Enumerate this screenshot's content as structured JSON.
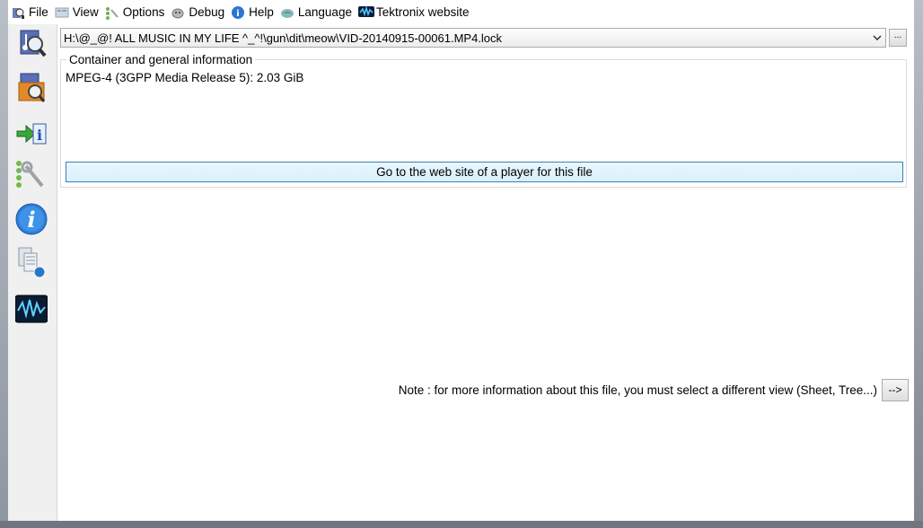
{
  "menu": {
    "items": [
      {
        "label": "File",
        "icon": "file-icon"
      },
      {
        "label": "View",
        "icon": "view-icon"
      },
      {
        "label": "Options",
        "icon": "options-icon"
      },
      {
        "label": "Debug",
        "icon": "debug-icon"
      },
      {
        "label": "Help",
        "icon": "help-icon"
      },
      {
        "label": "Language",
        "icon": "language-icon"
      },
      {
        "label": "Tektronix website",
        "icon": "tektronix-icon"
      }
    ]
  },
  "toolbar": {
    "tools": [
      {
        "name": "open-file-icon"
      },
      {
        "name": "open-folder-icon"
      },
      {
        "name": "export-icon"
      },
      {
        "name": "preferences-icon"
      },
      {
        "name": "about-icon"
      },
      {
        "name": "knowledge-base-icon"
      },
      {
        "name": "tektronix-waveform-icon"
      }
    ]
  },
  "file": {
    "path": "H:\\@_@! ALL MUSIC IN MY LIFE ^_^!\\gun\\dit\\meow\\VID-20140915-00061.MP4.lock",
    "browse_label": "..."
  },
  "general": {
    "legend": "Container and general information",
    "format": "MPEG-4 (3GPP Media Release 5): 2.03 GiB",
    "player_button": "Go to the web site of a player for this file"
  },
  "note": {
    "text": "Note : for more information about this file, you must select a different view (Sheet, Tree...)",
    "arrow_label": "-->"
  },
  "colors": {
    "accent_border": "#3c7fb1",
    "button_fill": "#e3f3fc"
  }
}
